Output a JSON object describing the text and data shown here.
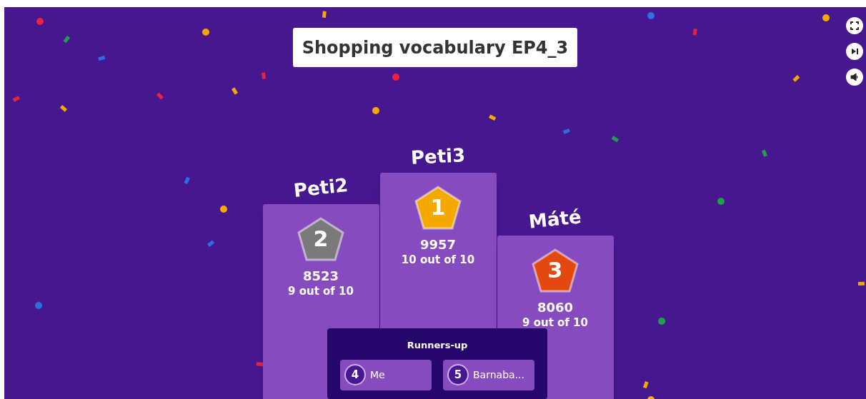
{
  "title": "Shopping vocabulary EP4_3",
  "podium": [
    {
      "name": "Peti2",
      "rank": "2",
      "score": "8523",
      "result": "9 out of 10",
      "color": "#7a7a7a"
    },
    {
      "name": "Peti3",
      "rank": "1",
      "score": "9957",
      "result": "10 out of 10",
      "color": "#f5a800"
    },
    {
      "name": "Máté",
      "rank": "3",
      "score": "8060",
      "result": "9 out of 10",
      "color": "#e2480f"
    }
  ],
  "runners_up": {
    "title": "Runners-up",
    "players": [
      {
        "rank": "4",
        "name": "Me"
      },
      {
        "rank": "5",
        "name": "Barnaba..."
      }
    ]
  }
}
